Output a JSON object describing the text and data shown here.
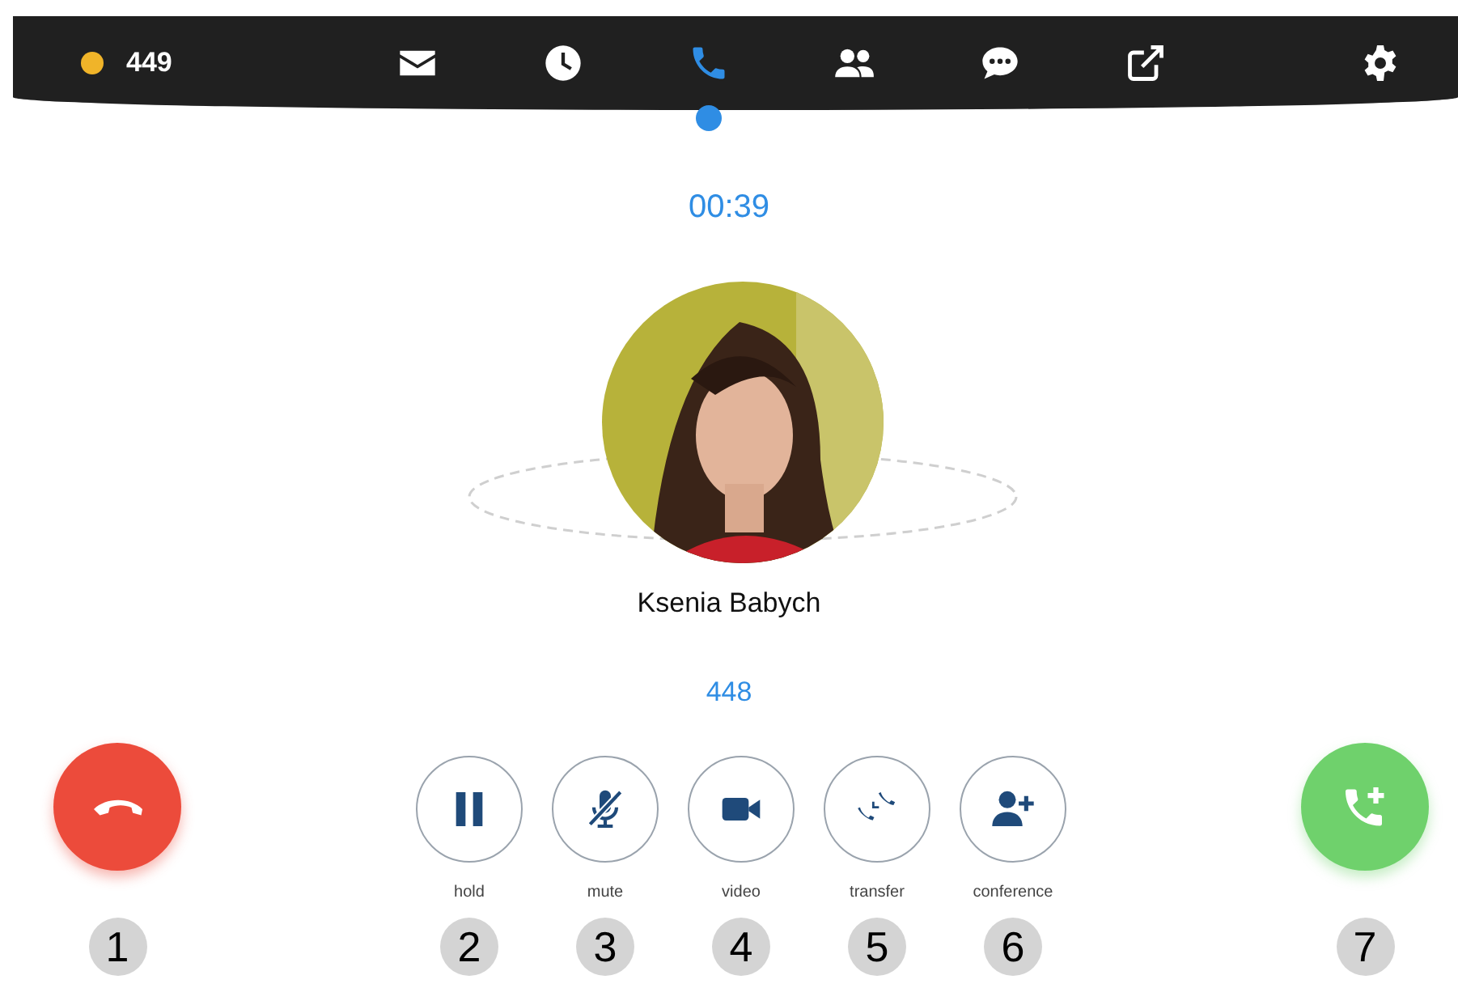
{
  "nav": {
    "status": {
      "color": "#f0b429",
      "extension": "449"
    },
    "tabs": [
      {
        "selected": false
      },
      {
        "selected": false
      },
      {
        "selected": true
      },
      {
        "selected": false
      },
      {
        "selected": false
      },
      {
        "selected": false
      }
    ]
  },
  "call": {
    "timer": "00:39",
    "name": "Ksenia Babych",
    "number": "448"
  },
  "actions": [
    {
      "kind": "hangup",
      "badge": "1"
    },
    {
      "kind": "action",
      "label": "hold",
      "badge": "2"
    },
    {
      "kind": "action",
      "label": "mute",
      "badge": "3"
    },
    {
      "kind": "action",
      "label": "video",
      "badge": "4"
    },
    {
      "kind": "action",
      "label": "transfer",
      "badge": "5"
    },
    {
      "kind": "action",
      "label": "conference",
      "badge": "6"
    },
    {
      "kind": "addcall",
      "badge": "7"
    }
  ]
}
